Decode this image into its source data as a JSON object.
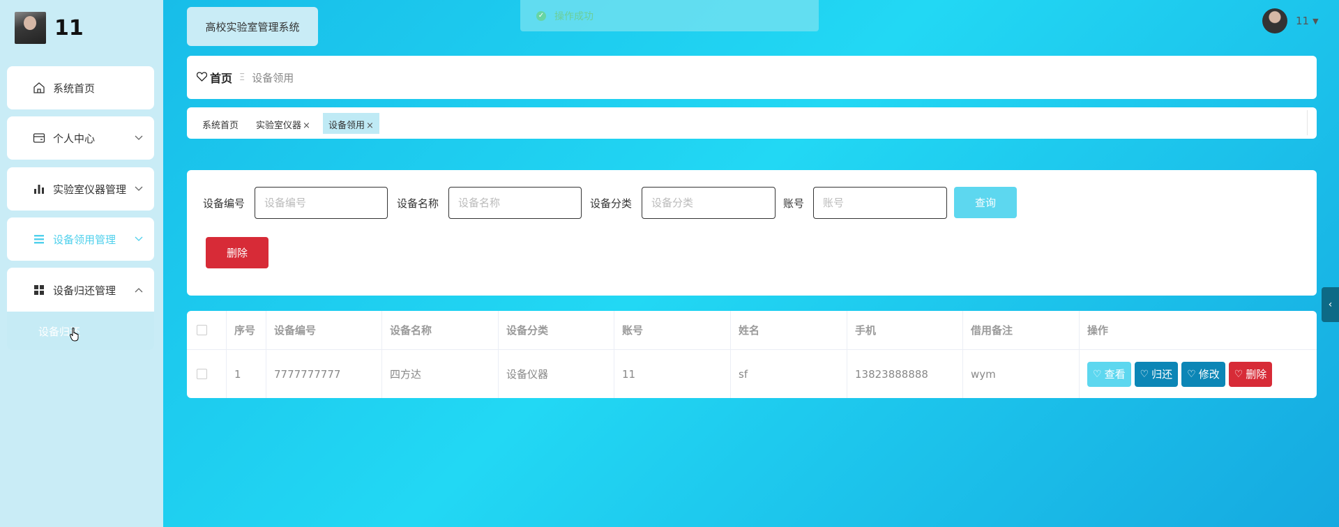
{
  "brand": {
    "name": "11"
  },
  "sidebar": {
    "items": [
      {
        "label": "系统首页",
        "icon": "home-icon"
      },
      {
        "label": "个人中心",
        "icon": "wallet-icon"
      },
      {
        "label": "实验室仪器管理",
        "icon": "bar-chart-icon"
      },
      {
        "label": "设备领用管理",
        "icon": "list-icon"
      },
      {
        "label": "设备归还管理",
        "icon": "grid-icon"
      }
    ],
    "submenu_label": "设备归还"
  },
  "header": {
    "system_title": "高校实验室管理系统",
    "toast": "操作成功",
    "username": "11"
  },
  "breadcrumb": {
    "home": "首页",
    "separator": "Ξ",
    "current": "设备领用"
  },
  "tabs": [
    {
      "label": "系统首页",
      "closable": false
    },
    {
      "label": "实验室仪器",
      "closable": true
    },
    {
      "label": "设备领用",
      "closable": true,
      "active": true
    }
  ],
  "search": {
    "fields": [
      {
        "label": "设备编号",
        "placeholder": "设备编号"
      },
      {
        "label": "设备名称",
        "placeholder": "设备名称"
      },
      {
        "label": "设备分类",
        "placeholder": "设备分类"
      },
      {
        "label": "账号",
        "placeholder": "账号"
      }
    ],
    "query_label": "查询",
    "delete_label": "删除"
  },
  "table": {
    "headers": [
      "序号",
      "设备编号",
      "设备名称",
      "设备分类",
      "账号",
      "姓名",
      "手机",
      "借用备注",
      "操作"
    ],
    "rows": [
      [
        "1",
        "7777777777",
        "四方达",
        "设备仪器",
        "11",
        "sf",
        "13823888888",
        "wym"
      ]
    ],
    "actions": [
      "查看",
      "归还",
      "修改",
      "删除"
    ]
  },
  "colors": {
    "accent": "#5dd7ef",
    "danger": "#d72b37",
    "primary_dark": "#0c86b6"
  }
}
